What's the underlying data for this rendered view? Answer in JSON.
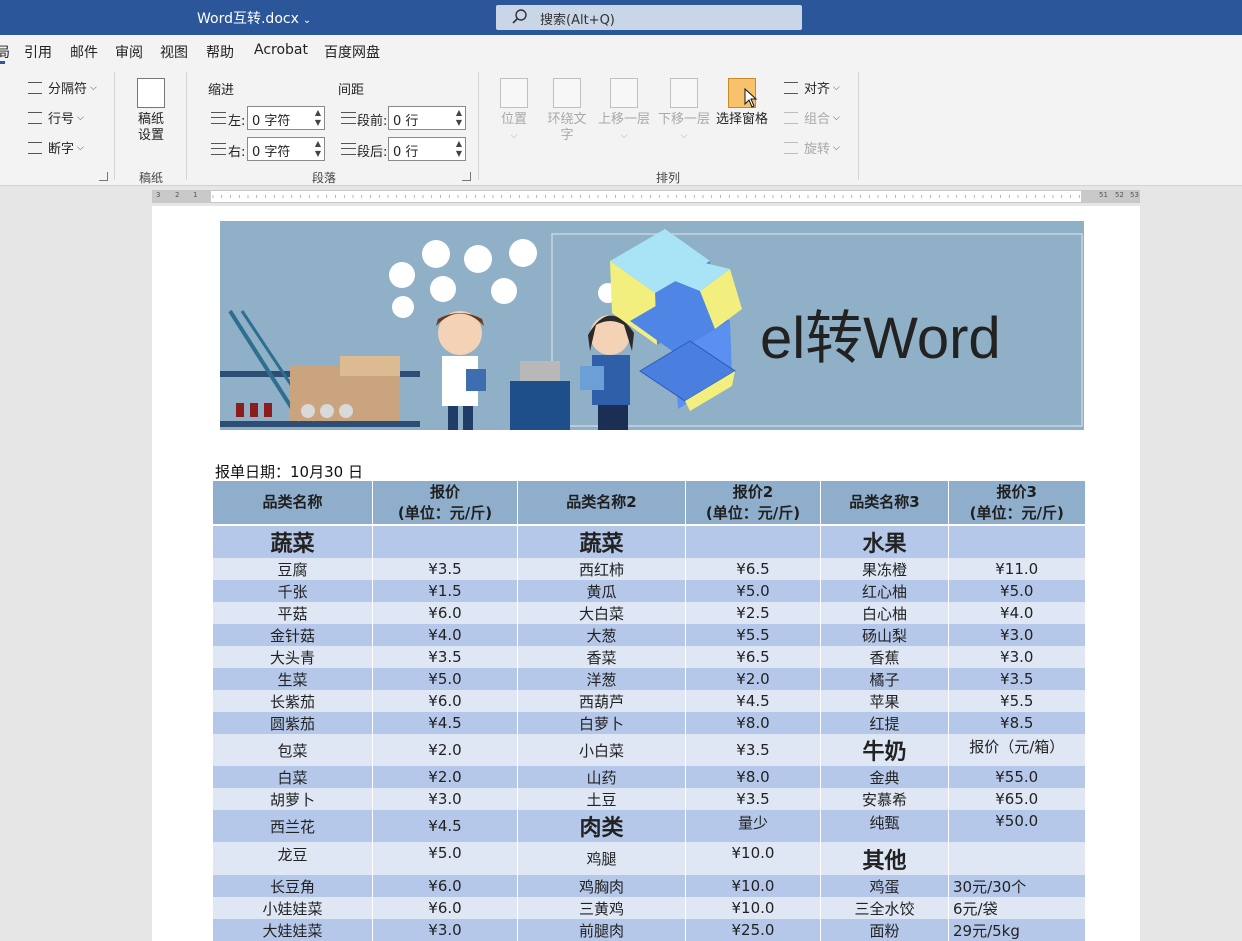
{
  "app": {
    "doc_title": "Word互转.docx",
    "search_placeholder": "搜索(Alt+Q)"
  },
  "tabs": [
    {
      "label": "局"
    },
    {
      "label": "引用"
    },
    {
      "label": "邮件"
    },
    {
      "label": "审阅"
    },
    {
      "label": "视图"
    },
    {
      "label": "帮助"
    },
    {
      "label": "Acrobat"
    },
    {
      "label": "百度网盘"
    }
  ],
  "ribbon": {
    "page_setup": {
      "breaks": "分隔符",
      "line_numbers": "行号",
      "hyphenation": "断字"
    },
    "manuscript": {
      "button_line1": "稿纸",
      "button_line2": "设置",
      "group_label": "稿纸"
    },
    "paragraph": {
      "indent_heading": "缩进",
      "spacing_heading": "间距",
      "left_label": "左:",
      "left_value": "0 字符",
      "right_label": "右:",
      "right_value": "0 字符",
      "before_label": "段前:",
      "before_value": "0 行",
      "after_label": "段后:",
      "after_value": "0 行",
      "group_label": "段落"
    },
    "arrange": {
      "position": "位置",
      "wrap_line1": "环绕文",
      "wrap_line2": "字",
      "bring_forward": "上移一层",
      "send_backward": "下移一层",
      "selection_pane": "选择窗格",
      "align": "对齐",
      "group": "组合",
      "rotate": "旋转",
      "group_label": "排列"
    }
  },
  "ruler": {
    "left_ticks": [
      "3",
      "2",
      "1"
    ],
    "right_ticks": [
      "51",
      "52",
      "53"
    ]
  },
  "document": {
    "banner_title": "el转Word",
    "date_line": "报单日期：10月30 日",
    "table": {
      "headers": [
        {
          "line1": "品类名称",
          "line2": ""
        },
        {
          "line1": "报价",
          "line2": "(单位：元/斤)"
        },
        {
          "line1": "品类名称2",
          "line2": ""
        },
        {
          "line1": "报价2",
          "line2": "(单位：元/斤)"
        },
        {
          "line1": "品类名称3",
          "line2": ""
        },
        {
          "line1": "报价3",
          "line2": "(单位：元/斤)"
        }
      ],
      "rows": [
        [
          "蔬菜",
          "",
          "蔬菜",
          "",
          "水果",
          ""
        ],
        [
          "豆腐",
          "¥3.5",
          "西红柿",
          "¥6.5",
          "果冻橙",
          "¥11.0"
        ],
        [
          "千张",
          "¥1.5",
          "黄瓜",
          "¥5.0",
          "红心柚",
          "¥5.0"
        ],
        [
          "平菇",
          "¥6.0",
          "大白菜",
          "¥2.5",
          "白心柚",
          "¥4.0"
        ],
        [
          "金针菇",
          "¥4.0",
          "大葱",
          "¥5.5",
          "砀山梨",
          "¥3.0"
        ],
        [
          "大头青",
          "¥3.5",
          "香菜",
          "¥6.5",
          "香蕉",
          "¥3.0"
        ],
        [
          "生菜",
          "¥5.0",
          "洋葱",
          "¥2.0",
          "橘子",
          "¥3.5"
        ],
        [
          "长紫茄",
          "¥6.0",
          "西葫芦",
          "¥4.5",
          "苹果",
          "¥5.5"
        ],
        [
          "圆紫茄",
          "¥4.5",
          "白萝卜",
          "¥8.0",
          "红提",
          "¥8.5"
        ],
        [
          "包菜",
          "¥2.0",
          "小白菜",
          "¥3.5",
          "牛奶",
          "报价（元/箱）"
        ],
        [
          "白菜",
          "¥2.0",
          "山药",
          "¥8.0",
          "金典",
          "¥55.0"
        ],
        [
          "胡萝卜",
          "¥3.0",
          "土豆",
          "¥3.5",
          "安慕希",
          "¥65.0"
        ],
        [
          "西兰花",
          "¥4.5",
          "肉类",
          "量少",
          "纯甄",
          "¥50.0"
        ],
        [
          "龙豆",
          "¥5.0",
          "鸡腿",
          "¥10.0",
          "其他",
          ""
        ],
        [
          "长豆角",
          "¥6.0",
          "鸡胸肉",
          "¥10.0",
          "鸡蛋",
          "30元/30个"
        ],
        [
          "小娃娃菜",
          "¥6.0",
          "三黄鸡",
          "¥10.0",
          "三全水饺",
          "6元/袋"
        ],
        [
          "大娃娃菜",
          "¥3.0",
          "前腿肉",
          "¥25.0",
          "面粉",
          "29元/5kg"
        ]
      ]
    }
  }
}
